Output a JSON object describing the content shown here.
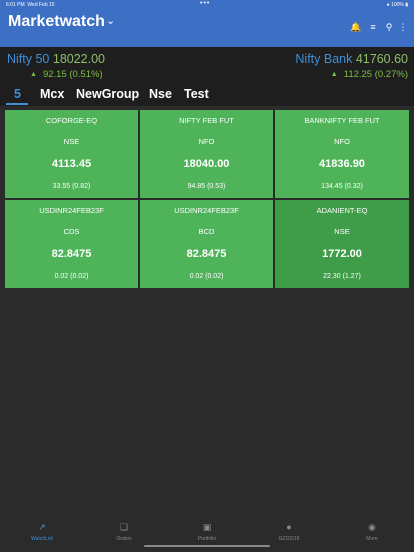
{
  "status_bar": {
    "time": "6:01 PM",
    "date": "Wed Feb 15",
    "battery": "100%",
    "dots": "•••"
  },
  "header": {
    "title": "Marketwatch"
  },
  "icons": {
    "chevron": "chevron-down-icon",
    "bell": "bell-icon",
    "sort": "sort-icon",
    "search": "search-icon",
    "more": "more-vertical-icon"
  },
  "indices": [
    {
      "name": "Nifty 50",
      "value": "18022.00",
      "change": "92.15 (0.51%)",
      "direction": "up"
    },
    {
      "name": "Nifty Bank",
      "value": "41760.60",
      "change": "112.25 (0.27%)",
      "direction": "up"
    }
  ],
  "tabs": [
    {
      "label": "5",
      "active": true
    },
    {
      "label": "Mcx",
      "active": false
    },
    {
      "label": "NewGroup",
      "active": false
    },
    {
      "label": "Nse",
      "active": false
    },
    {
      "label": "Test",
      "active": false
    }
  ],
  "watchlist": [
    {
      "symbol": "COFORGE-EQ",
      "exchange": "NSE",
      "ltp": "4113.45",
      "change": "33.55 (0.82)"
    },
    {
      "symbol": "NIFTY FEB FUT",
      "exchange": "NFO",
      "ltp": "18040.00",
      "change": "94.85 (0.53)"
    },
    {
      "symbol": "BANKNIFTY FEB FUT",
      "exchange": "NFO",
      "ltp": "41836.90",
      "change": "134.45 (0.32)"
    },
    {
      "symbol": "USDINR24FEB23F",
      "exchange": "CDS",
      "ltp": "82.8475",
      "change": "0.02 (0.02)"
    },
    {
      "symbol": "USDINR24FEB23F",
      "exchange": "BCD",
      "ltp": "82.8475",
      "change": "0.02 (0.02)"
    },
    {
      "symbol": "ADANIENT-EQ",
      "exchange": "NSE",
      "ltp": "1772.00",
      "change": "22.30 (1.27)"
    }
  ],
  "bottom_nav": [
    {
      "label": "WatchList",
      "icon": "chart-line-icon",
      "active": true
    },
    {
      "label": "Orders",
      "icon": "orders-icon",
      "active": false
    },
    {
      "label": "Portfolio",
      "icon": "briefcase-icon",
      "active": false
    },
    {
      "label": "GZ10216",
      "icon": "user-icon",
      "active": false
    },
    {
      "label": "More",
      "icon": "more-icon",
      "active": false
    }
  ],
  "colors": {
    "header": "#3d6fc4",
    "accent_blue": "#3f8fd6",
    "gain_green": "#4fb35a",
    "gain_text": "#7cc043",
    "background": "#2b2b2b"
  }
}
